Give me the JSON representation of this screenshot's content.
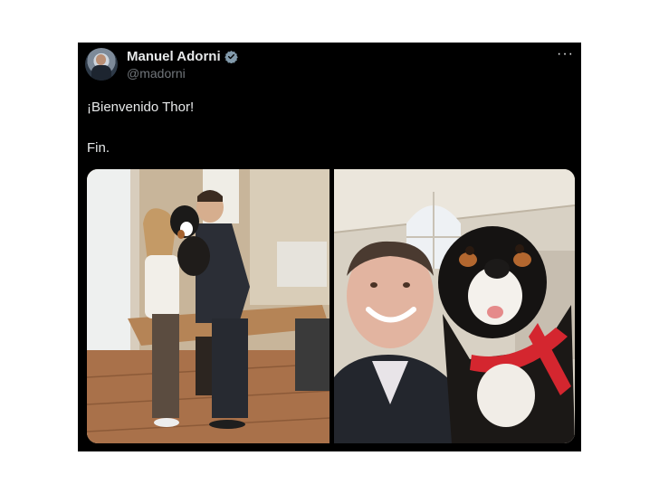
{
  "post": {
    "author_name": "Manuel Adorni",
    "author_handle": "@madorni",
    "more_label": "···",
    "lines": [
      "¡Bienvenido Thor!",
      "Fin."
    ]
  },
  "media": [
    {
      "description": "office-photo-couple-with-dog"
    },
    {
      "description": "selfie-man-with-bernese-dog"
    }
  ],
  "colors": {
    "background": "#000000",
    "text": "#e7e9ea",
    "secondary_text": "#71767b",
    "verified": "#829aab"
  },
  "icons": [
    "verified-badge-icon",
    "more-options-icon"
  ]
}
